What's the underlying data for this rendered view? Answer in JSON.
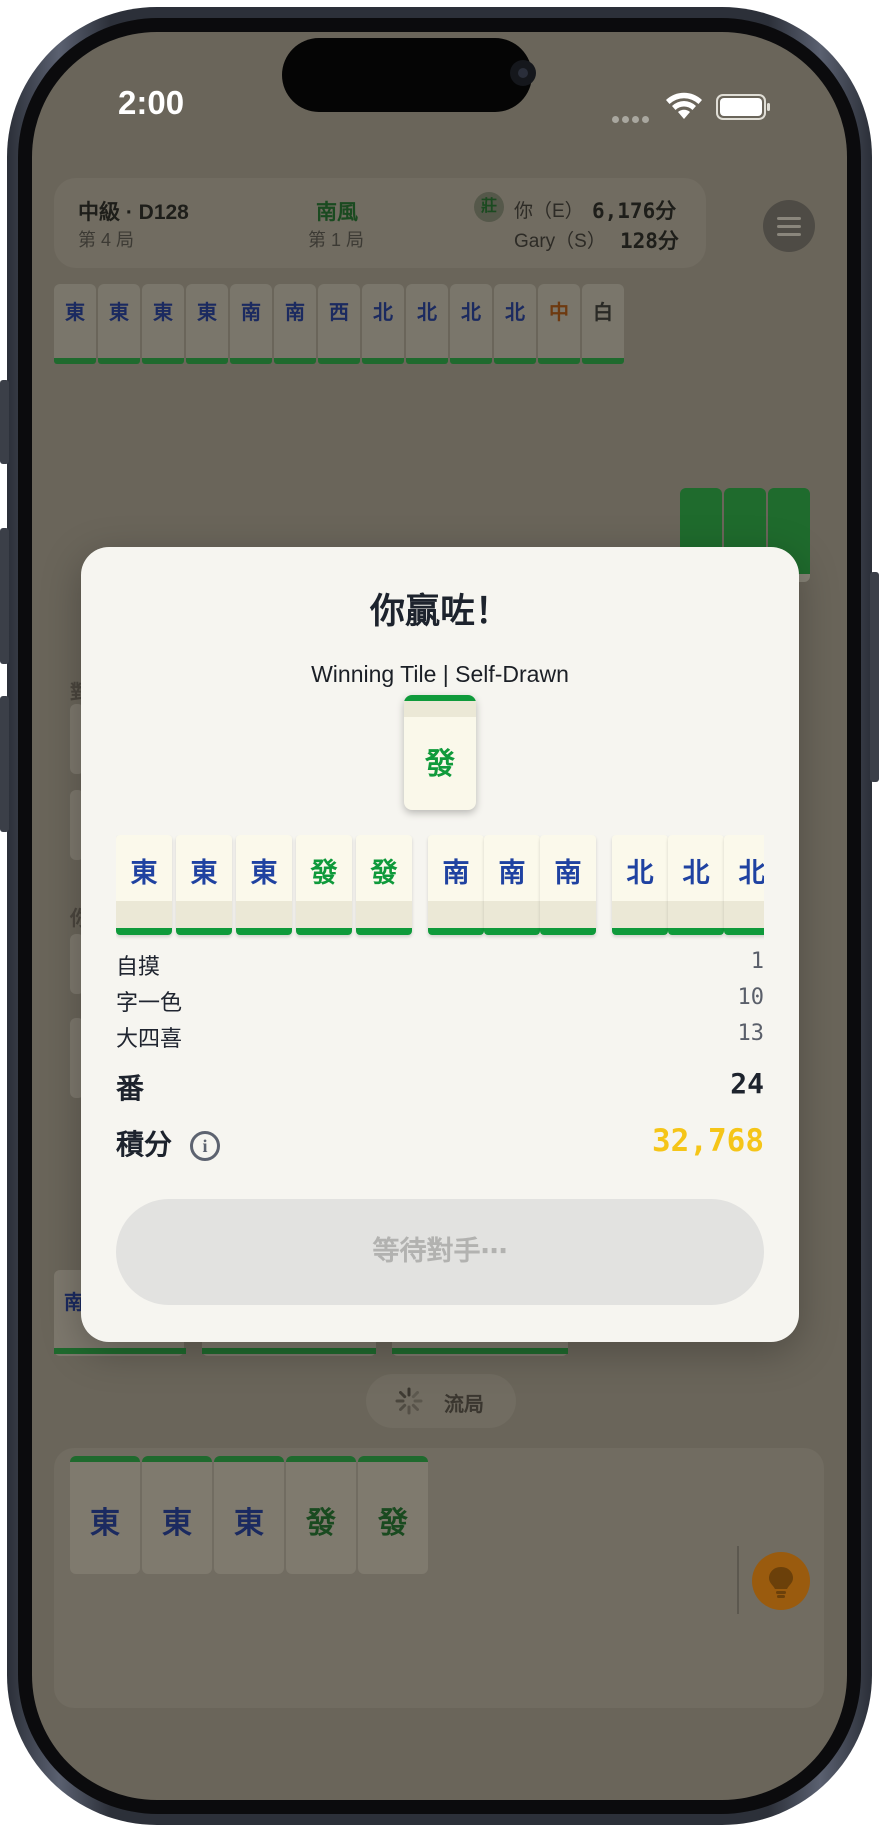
{
  "status_bar": {
    "time": "2:00"
  },
  "header": {
    "level": "中級 · D128",
    "round": "第 4 局",
    "wind": "南風",
    "hand": "第 1 局",
    "dealer_badge": "莊",
    "player1_name": "你（E）",
    "player1_score": "6,176分",
    "player2_name": "Gary（S）",
    "player2_score": "128分"
  },
  "opponent_melds": [
    "東",
    "東",
    "東",
    "東",
    "南",
    "南",
    "西",
    "北",
    "北",
    "北",
    "北",
    "中",
    "白"
  ],
  "background": {
    "partial_text": "南",
    "draw_label": "流局",
    "side_char_1": "對",
    "side_char_2": "你"
  },
  "player_hand": [
    "東",
    "東",
    "東",
    "發",
    "發"
  ],
  "modal": {
    "title": "你贏咗！",
    "subtitle": "Winning Tile | Self-Drawn",
    "winning_tile": "發",
    "hand_tiles": [
      {
        "char": "東",
        "color": "blue"
      },
      {
        "char": "東",
        "color": "blue"
      },
      {
        "char": "東",
        "color": "blue"
      },
      {
        "char": "發",
        "color": "green"
      },
      {
        "char": "發",
        "color": "green"
      },
      {
        "char": "南",
        "color": "blue"
      },
      {
        "char": "南",
        "color": "blue"
      },
      {
        "char": "南",
        "color": "blue"
      },
      {
        "char": "北",
        "color": "blue"
      },
      {
        "char": "北",
        "color": "blue"
      },
      {
        "char": "北",
        "color": "blue"
      }
    ],
    "fan_items": [
      {
        "name": "自摸",
        "value": "1"
      },
      {
        "name": "字一色",
        "value": "10"
      },
      {
        "name": "大四喜",
        "value": "13"
      }
    ],
    "fan_total_label": "番",
    "fan_total": "24",
    "score_label": "積分",
    "score_value": "32,768",
    "wait_button": "等待對手⋯"
  },
  "colors": {
    "score": "#f5c518",
    "tile_green": "#0f9a3b",
    "tile_blue": "#1f42a1",
    "overlay": "#6a655a"
  }
}
